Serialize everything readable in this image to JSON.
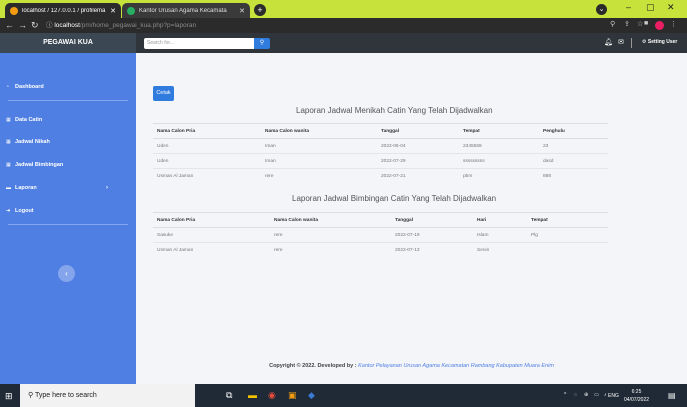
{
  "browser": {
    "tabs": [
      {
        "title": "localhost / 127.0.0.1 / profilema"
      },
      {
        "title": "Kantor Urusan Agama Kecamata"
      }
    ],
    "url_host": "localhost",
    "url_path": "/pm/home_pegawai_kua.php?p=laporan"
  },
  "app": {
    "brand": "PEGAWAI KUA",
    "search_placeholder": "Search for...",
    "setting_label": "Setting User"
  },
  "sidebar": {
    "items": [
      {
        "label": "Dashboard",
        "icon": "dashboard-icon"
      },
      {
        "label": "Data Catin",
        "icon": "table-icon"
      },
      {
        "label": "Jadwal Nikah",
        "icon": "table-icon"
      },
      {
        "label": "Jadwal Bimbingan",
        "icon": "table-icon"
      },
      {
        "label": "Laporan",
        "icon": "folder-icon"
      },
      {
        "label": "Logout",
        "icon": "logout-icon"
      }
    ]
  },
  "main": {
    "cetak_label": "Cetak",
    "nikah": {
      "title": "Laporan Jadwal Menikah Catin Yang Telah Dijadwalkan",
      "headers": [
        "Nama Calon Pria",
        "Nama Calon wanita",
        "Tanggal",
        "Tempat",
        "Penghulu"
      ],
      "rows": [
        [
          "Uden",
          "Iman",
          "2022-06-04",
          "2345559",
          "23"
        ],
        [
          "Uden",
          "Iman",
          "2022-07-29",
          "sssssssss",
          "dasd"
        ],
        [
          "Usman Al Jaman",
          "rere",
          "2022-07-21",
          "pbm",
          "888"
        ]
      ]
    },
    "bimbingan": {
      "title": "Laporan Jadwal Bimbingan Catin Yang Telah Dijadwalkan",
      "headers": [
        "Nama Calon Pria",
        "Nama Calon wanita",
        "Tanggal",
        "Hari",
        "Tempat"
      ],
      "rows": [
        [
          "Sasuke",
          "rere",
          "2022-07-19",
          "Islam",
          "Plg"
        ],
        [
          "Usman Al Jaman",
          "rere",
          "2022-07-13",
          "Senin",
          ""
        ]
      ]
    },
    "footer_prefix": "Copyright © 2022. Developed by :",
    "footer_org": "Kantor Pelayanan Urusan Agama Kecamatan Rambang Kabupaten Muara Enim"
  },
  "taskbar": {
    "search_placeholder": "Type here to search",
    "lang": "ENG",
    "time": "6:25",
    "date": "04/07/2022"
  }
}
